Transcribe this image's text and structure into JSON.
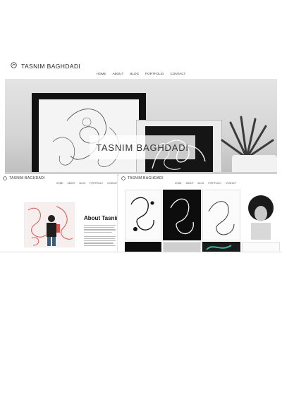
{
  "site": {
    "brand": "TASNIM BAGHDADI",
    "nav": [
      "HOME",
      "ABOUT",
      "BLOG",
      "PORTFOLIO",
      "CONTACT"
    ]
  },
  "hero": {
    "title": "TASNIM BAGHDADI"
  },
  "about_page": {
    "brand": "TASNIM BAGHDADI",
    "nav": [
      "HOME",
      "ABOUT",
      "BLOG",
      "PORTFOLIO",
      "CONTACT"
    ],
    "heading": "About Tasnim"
  },
  "portfolio_page": {
    "brand": "TASNIM BAGHDADI",
    "nav": [
      "HOME",
      "ABOUT",
      "BLOG",
      "PORTFOLIO",
      "CONTACT"
    ]
  },
  "colors": {
    "accent_red": "#d9534f",
    "text_dark": "#222222",
    "background": "#ffffff"
  }
}
